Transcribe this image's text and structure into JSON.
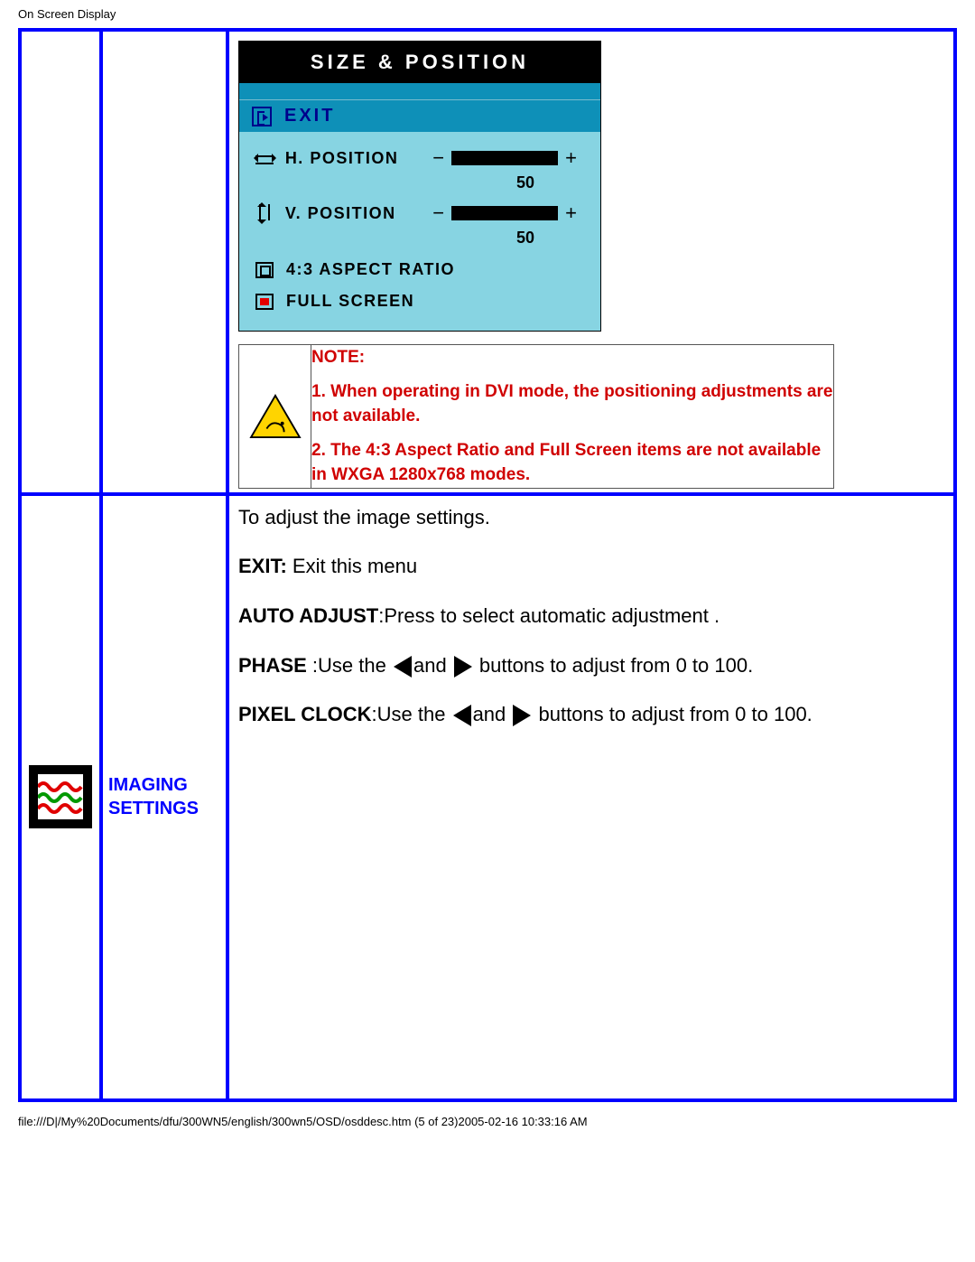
{
  "header": "On Screen Display",
  "osd": {
    "title": "SIZE & POSITION",
    "exit": "EXIT",
    "h_position": {
      "label": "H. POSITION",
      "value": "50"
    },
    "v_position": {
      "label": "V. POSITION",
      "value": "50"
    },
    "aspect_ratio": "4:3 ASPECT RATIO",
    "full_screen": "FULL SCREEN"
  },
  "note": {
    "heading": "NOTE:",
    "line1": "1. When operating in DVI mode, the positioning adjustments are not available.",
    "line2": "2. The 4:3 Aspect Ratio and Full Screen items are not available in WXGA 1280x768 modes."
  },
  "section2": {
    "label": "IMAGING SETTINGS",
    "intro": "To adjust the image settings.",
    "exit_bold": "EXIT:",
    "exit_text": " Exit this menu",
    "auto_bold": "AUTO ADJUST",
    "auto_text": ":Press to select automatic adjustment .",
    "phase_bold": "PHASE ",
    "phase_pre": ":Use the ",
    "phase_mid": "and ",
    "phase_post": " buttons to adjust from 0 to 100.",
    "pixel_bold": "PIXEL CLOCK",
    "pixel_pre": ":Use the ",
    "pixel_mid": "and ",
    "pixel_post": " buttons to adjust from 0 to 100."
  },
  "footer": "file:///D|/My%20Documents/dfu/300WN5/english/300wn5/OSD/osddesc.htm (5 of 23)2005-02-16 10:33:16 AM"
}
